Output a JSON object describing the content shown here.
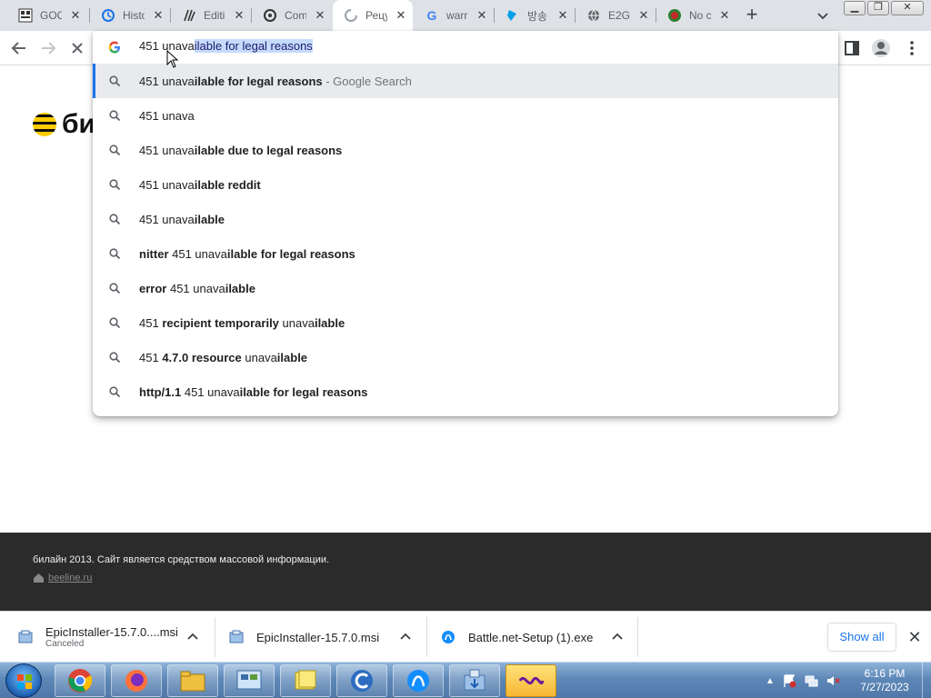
{
  "tabs": [
    {
      "title": "GOOG",
      "icon": "goog-grid-icon"
    },
    {
      "title": "Histo",
      "icon": "history-icon"
    },
    {
      "title": "Editi",
      "icon": "steemit-icon"
    },
    {
      "title": "Com",
      "icon": "odoo-icon"
    },
    {
      "title": "Рецу",
      "icon": "loading-spinner-icon",
      "active": true
    },
    {
      "title": "warr",
      "icon": "google-icon"
    },
    {
      "title": "방송",
      "icon": "broadcast-icon"
    },
    {
      "title": "E2G",
      "icon": "globe-icon"
    },
    {
      "title": "No c",
      "icon": "brand-seal-icon"
    }
  ],
  "window_controls": {
    "minimize": "▁",
    "maximize": "❐",
    "close": "✕"
  },
  "omnibox": {
    "typed": "451 unava",
    "autocompleted": "ilable for legal reasons"
  },
  "suggestions": [
    {
      "parts": [
        {
          "t": "451 unava",
          "b": false
        },
        {
          "t": "ilable for legal reasons",
          "b": true
        }
      ],
      "sub": " - Google Search",
      "highlighted": true
    },
    {
      "parts": [
        {
          "t": "451 unava",
          "b": false
        }
      ],
      "sub": ""
    },
    {
      "parts": [
        {
          "t": "451 unava",
          "b": false
        },
        {
          "t": "ilable due to legal reasons",
          "b": true
        }
      ],
      "sub": ""
    },
    {
      "parts": [
        {
          "t": "451 unava",
          "b": false
        },
        {
          "t": "ilable reddit",
          "b": true
        }
      ],
      "sub": ""
    },
    {
      "parts": [
        {
          "t": "451 unava",
          "b": false
        },
        {
          "t": "ilable",
          "b": true
        }
      ],
      "sub": ""
    },
    {
      "parts": [
        {
          "t": "nitter ",
          "b": true
        },
        {
          "t": "451 unava",
          "b": false
        },
        {
          "t": "ilable for legal reasons",
          "b": true
        }
      ],
      "sub": ""
    },
    {
      "parts": [
        {
          "t": "error ",
          "b": true
        },
        {
          "t": "451 unava",
          "b": false
        },
        {
          "t": "ilable",
          "b": true
        }
      ],
      "sub": ""
    },
    {
      "parts": [
        {
          "t": "451 ",
          "b": false
        },
        {
          "t": "recipient temporarily ",
          "b": true
        },
        {
          "t": "unava",
          "b": false
        },
        {
          "t": "ilable",
          "b": true
        }
      ],
      "sub": ""
    },
    {
      "parts": [
        {
          "t": "451 ",
          "b": false
        },
        {
          "t": "4.7.0 resource ",
          "b": true
        },
        {
          "t": "unava",
          "b": false
        },
        {
          "t": "ilable",
          "b": true
        }
      ],
      "sub": ""
    },
    {
      "parts": [
        {
          "t": "http/1.1 ",
          "b": true
        },
        {
          "t": "451 unava",
          "b": false
        },
        {
          "t": "ilable for legal reasons",
          "b": true
        }
      ],
      "sub": ""
    }
  ],
  "page": {
    "brand_name": "би",
    "footer_text": "билайн 2013. Сайт является средством массовой информации.",
    "footer_link": "beeline.ru"
  },
  "downloads": [
    {
      "name": "EpicInstaller-15.7.0....msi",
      "status": "Canceled"
    },
    {
      "name": "EpicInstaller-15.7.0.msi",
      "status": ""
    },
    {
      "name": "Battle.net-Setup (1).exe",
      "status": ""
    }
  ],
  "downloads_show_all": "Show all",
  "taskbar": {
    "apps": [
      "chrome-icon",
      "firefox-icon",
      "file-explorer-icon",
      "control-panel-icon",
      "sticky-notes-icon",
      "ccleaner-icon",
      "battlenet-icon",
      "installer-icon",
      "visual-studio-icon"
    ],
    "time": "6:16 PM",
    "date": "7/27/2023"
  },
  "colors": {
    "accent": "#1a73e8",
    "selection": "#c6dafc",
    "footer_bg": "#2b2b2b"
  }
}
